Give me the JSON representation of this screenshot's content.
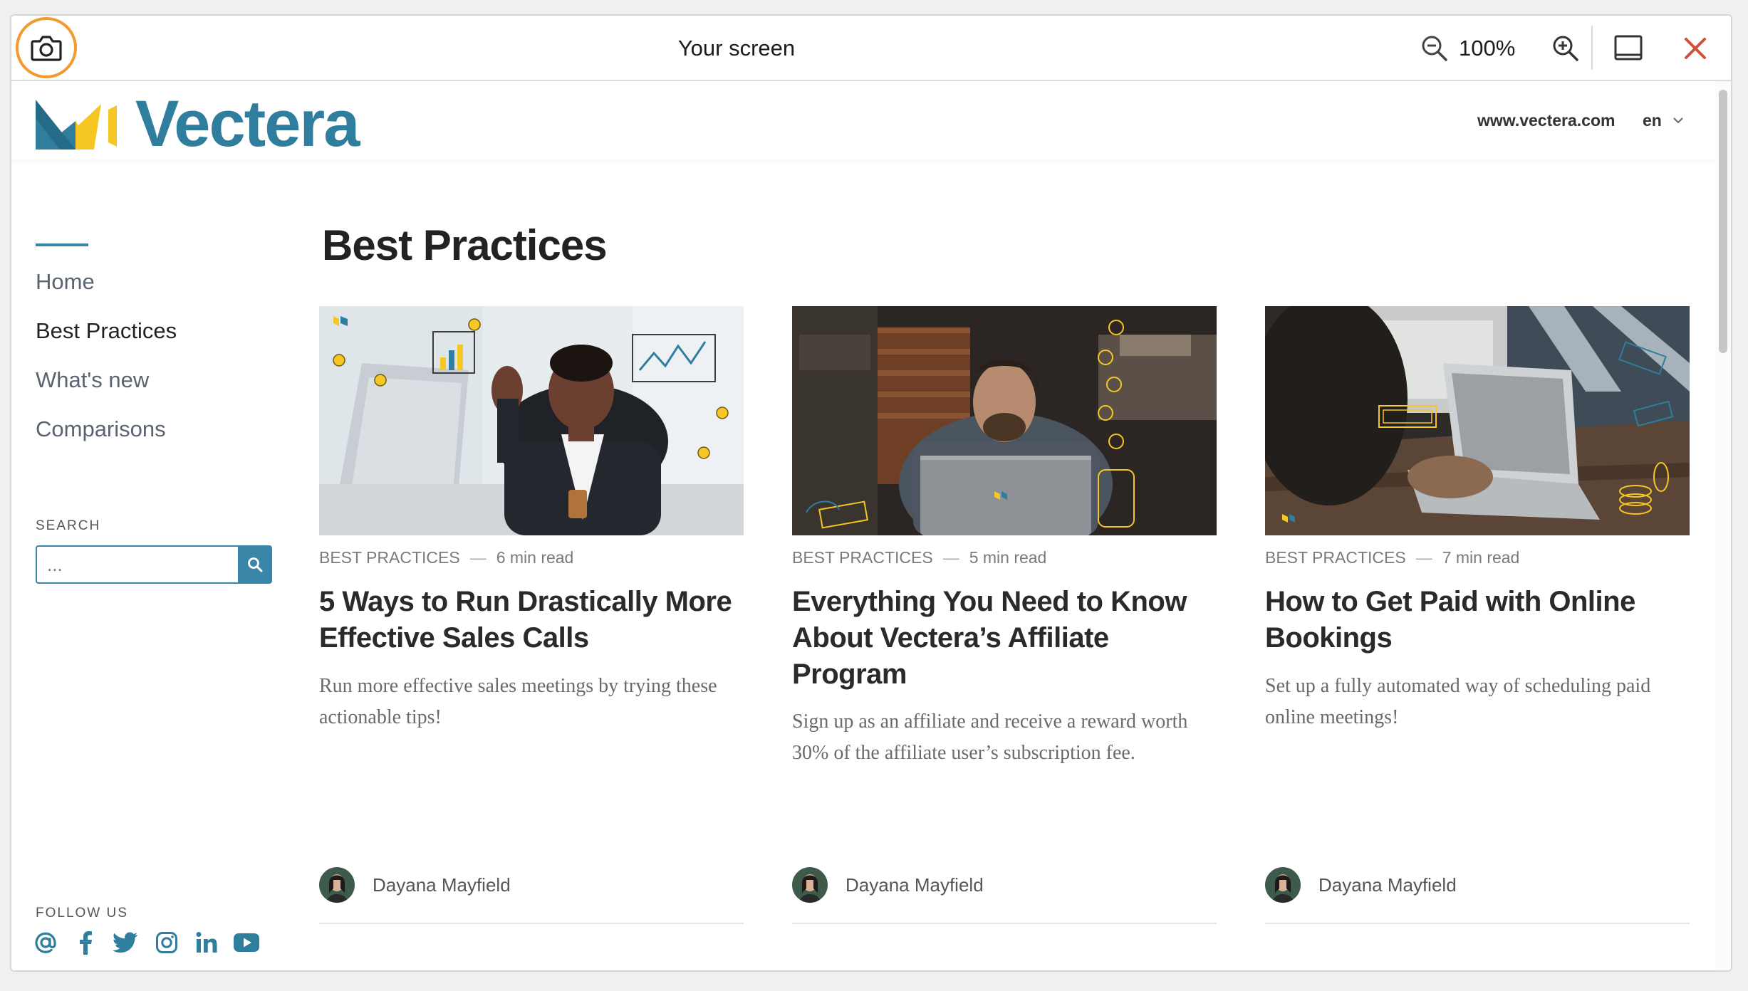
{
  "toolbar": {
    "title": "Your screen",
    "zoom": "100%"
  },
  "site": {
    "brand": "Vectera",
    "website_link": "www.vectera.com",
    "language": "en"
  },
  "sidebar": {
    "nav": [
      {
        "label": "Home",
        "active": false
      },
      {
        "label": "Best Practices",
        "active": true
      },
      {
        "label": "What's new",
        "active": false
      },
      {
        "label": "Comparisons",
        "active": false
      }
    ],
    "search_label": "SEARCH",
    "search_placeholder": "...",
    "follow_label": "FOLLOW US",
    "social_icons": [
      "email-at-icon",
      "facebook-icon",
      "twitter-icon",
      "instagram-icon",
      "linkedin-icon",
      "youtube-icon"
    ]
  },
  "main": {
    "title": "Best Practices",
    "cards": [
      {
        "category": "BEST PRACTICES",
        "read_time": "6 min read",
        "title": "5 Ways to Run Drastically More Effective Sales Calls",
        "description": "Run more effective sales meetings by trying these actionable tips!",
        "author": "Dayana Mayfield"
      },
      {
        "category": "BEST PRACTICES",
        "read_time": "5 min read",
        "title": "Everything You Need to Know About Vectera’s Affiliate Program",
        "description": "Sign up as an affiliate and receive a reward worth 30% of the affiliate user’s subscription fee.",
        "author": "Dayana Mayfield"
      },
      {
        "category": "BEST PRACTICES",
        "read_time": "7 min read",
        "title": "How to Get Paid with Online Bookings",
        "description": "Set up a fully automated way of scheduling paid online meetings!",
        "author": "Dayana Mayfield"
      }
    ]
  },
  "colors": {
    "brand_blue": "#2f7e9e",
    "brand_yellow": "#f6c623",
    "capture_ring": "#f29a2e",
    "close_red": "#d0503a"
  }
}
